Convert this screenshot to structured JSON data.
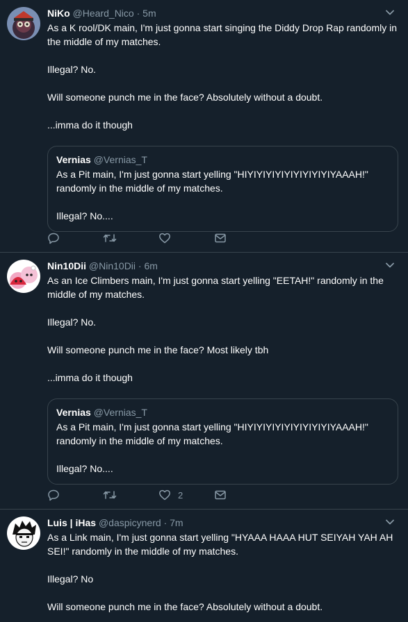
{
  "tweets": [
    {
      "name": "NiKo",
      "handle": "@Heard_Nico",
      "separator": "·",
      "time": "5m",
      "body": [
        "As a K rool/DK main, I'm just gonna start singing the Diddy Drop Rap randomly in the middle of my matches.",
        "Illegal? No.",
        "Will someone punch me in the face? Absolutely without a doubt.",
        "...imma do it though"
      ],
      "quote": {
        "name": "Vernias",
        "handle": "@Vernias_T",
        "body": [
          "As a Pit main, I'm just gonna start yelling \"HIYIYIYIYIYIYIYIYIYIYAAAH!\" randomly in the middle of my matches.",
          "Illegal? No...."
        ]
      },
      "like_count": ""
    },
    {
      "name": "Nin10Dii",
      "handle": "@Nin10Dii",
      "separator": "·",
      "time": "6m",
      "body": [
        "As an Ice Climbers main, I'm just gonna start yelling \"EETAH!\" randomly in the middle of my matches.",
        "Illegal? No.",
        "Will someone punch me in the face? Most likely tbh",
        "...imma do it though"
      ],
      "quote": {
        "name": "Vernias",
        "handle": "@Vernias_T",
        "body": [
          "As a Pit main, I'm just gonna start yelling \"HIYIYIYIYIYIYIYIYIYIYAAAH!\" randomly in the middle of my matches.",
          "Illegal? No...."
        ]
      },
      "like_count": "2"
    },
    {
      "name": "Luis | iHas",
      "handle": "@daspicynerd",
      "separator": "·",
      "time": "7m",
      "body": [
        "As a Link main, I'm just gonna start yelling \"HYAAA HAAA HUT SEIYAH YAH AH SEI!\" randomly in the middle of my matches.",
        "Illegal? No",
        "Will someone punch me in the face? Absolutely without a doubt."
      ]
    }
  ],
  "icons": {
    "reply": "reply-icon",
    "retweet": "retweet-icon",
    "like": "like-icon",
    "message": "direct-message-icon",
    "caret": "chevron-down-icon"
  },
  "colors": {
    "background": "#15202b",
    "border": "#38444d",
    "secondary_text": "#8899a6",
    "primary_text": "#ffffff"
  }
}
